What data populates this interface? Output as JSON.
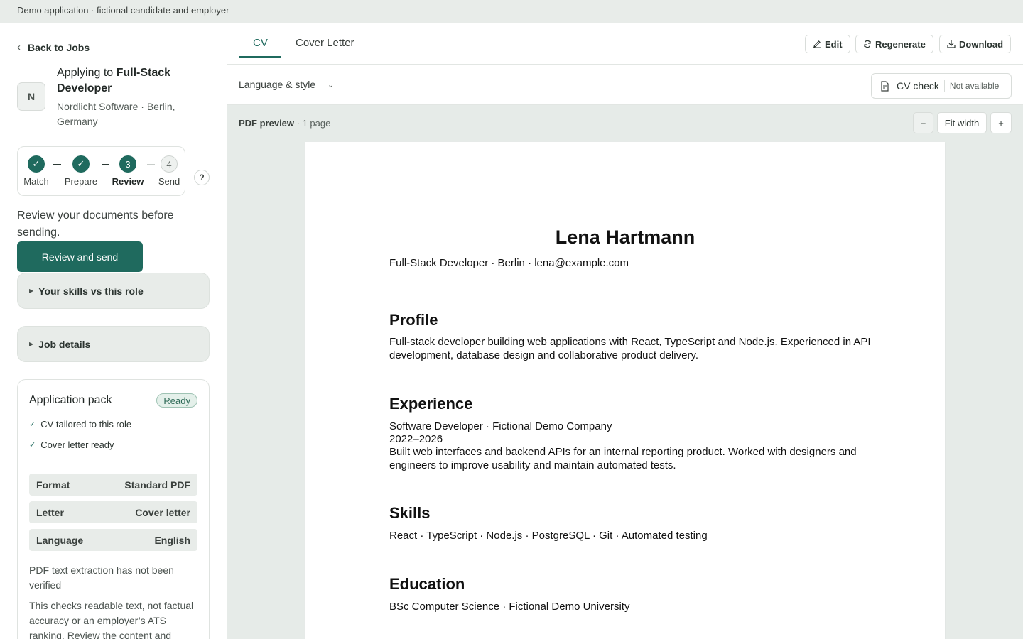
{
  "banner": "Demo application · fictional candidate and employer",
  "sidebar": {
    "back_label": "Back to Jobs",
    "avatar_letter": "N",
    "applying_prefix": "Applying to ",
    "role": "Full-Stack Developer",
    "company": "Nordlicht Software · Berlin, Germany",
    "steps": [
      {
        "label": "Match",
        "state": "done"
      },
      {
        "label": "Prepare",
        "state": "done"
      },
      {
        "label": "Review",
        "state": "current",
        "number": "3"
      },
      {
        "label": "Send",
        "state": "pending",
        "number": "4"
      }
    ],
    "help": "?",
    "review_text": "Review your documents before sending.",
    "review_button": "Review and send",
    "skills_section": "Your skills vs this role",
    "job_details_section": "Job details",
    "pack": {
      "title": "Application pack",
      "status": "Ready",
      "checks": [
        "CV tailored to this role",
        "Cover letter ready"
      ],
      "rows": [
        {
          "key": "Format",
          "value": "Standard PDF"
        },
        {
          "key": "Letter",
          "value": "Cover letter"
        },
        {
          "key": "Language",
          "value": "English"
        }
      ],
      "note1": "PDF text extraction has not been verified",
      "note2": "This checks readable text, not factual accuracy or an employer’s ATS ranking. Review the content and"
    }
  },
  "main": {
    "tabs": [
      "CV",
      "Cover Letter"
    ],
    "active_tab": "CV",
    "buttons": {
      "edit": "Edit",
      "regenerate": "Regenerate",
      "download": "Download"
    },
    "language_style": "Language & style",
    "cv_check": {
      "label": "CV check",
      "status": "Not available"
    },
    "preview": {
      "label": "PDF preview",
      "pages": " · 1 page",
      "zoom_out": "−",
      "fit": "Fit width",
      "zoom_in": "+"
    }
  },
  "cv": {
    "name": "Lena Hartmann",
    "contact": "Full-Stack Developer · Berlin · lena@example.com",
    "profile_heading": "Profile",
    "profile_text": "Full-stack developer building web applications with React, TypeScript and Node.js. Experienced in API development, database design and collaborative product delivery.",
    "experience_heading": "Experience",
    "job_title": "Software Developer · Fictional Demo Company",
    "job_years": "2022–2026",
    "job_text": "Built web interfaces and backend APIs for an internal reporting product. Worked with designers and engineers to improve usability and maintain automated tests.",
    "skills_heading": "Skills",
    "skills_text": "React · TypeScript · Node.js · PostgreSQL · Git · Automated testing",
    "education_heading": "Education",
    "education_text": "BSc Computer Science · Fictional Demo University"
  },
  "colors": {
    "accent": "#1f6a5e",
    "panel": "#e8ece9",
    "preview_bg": "#e6ebe8"
  }
}
